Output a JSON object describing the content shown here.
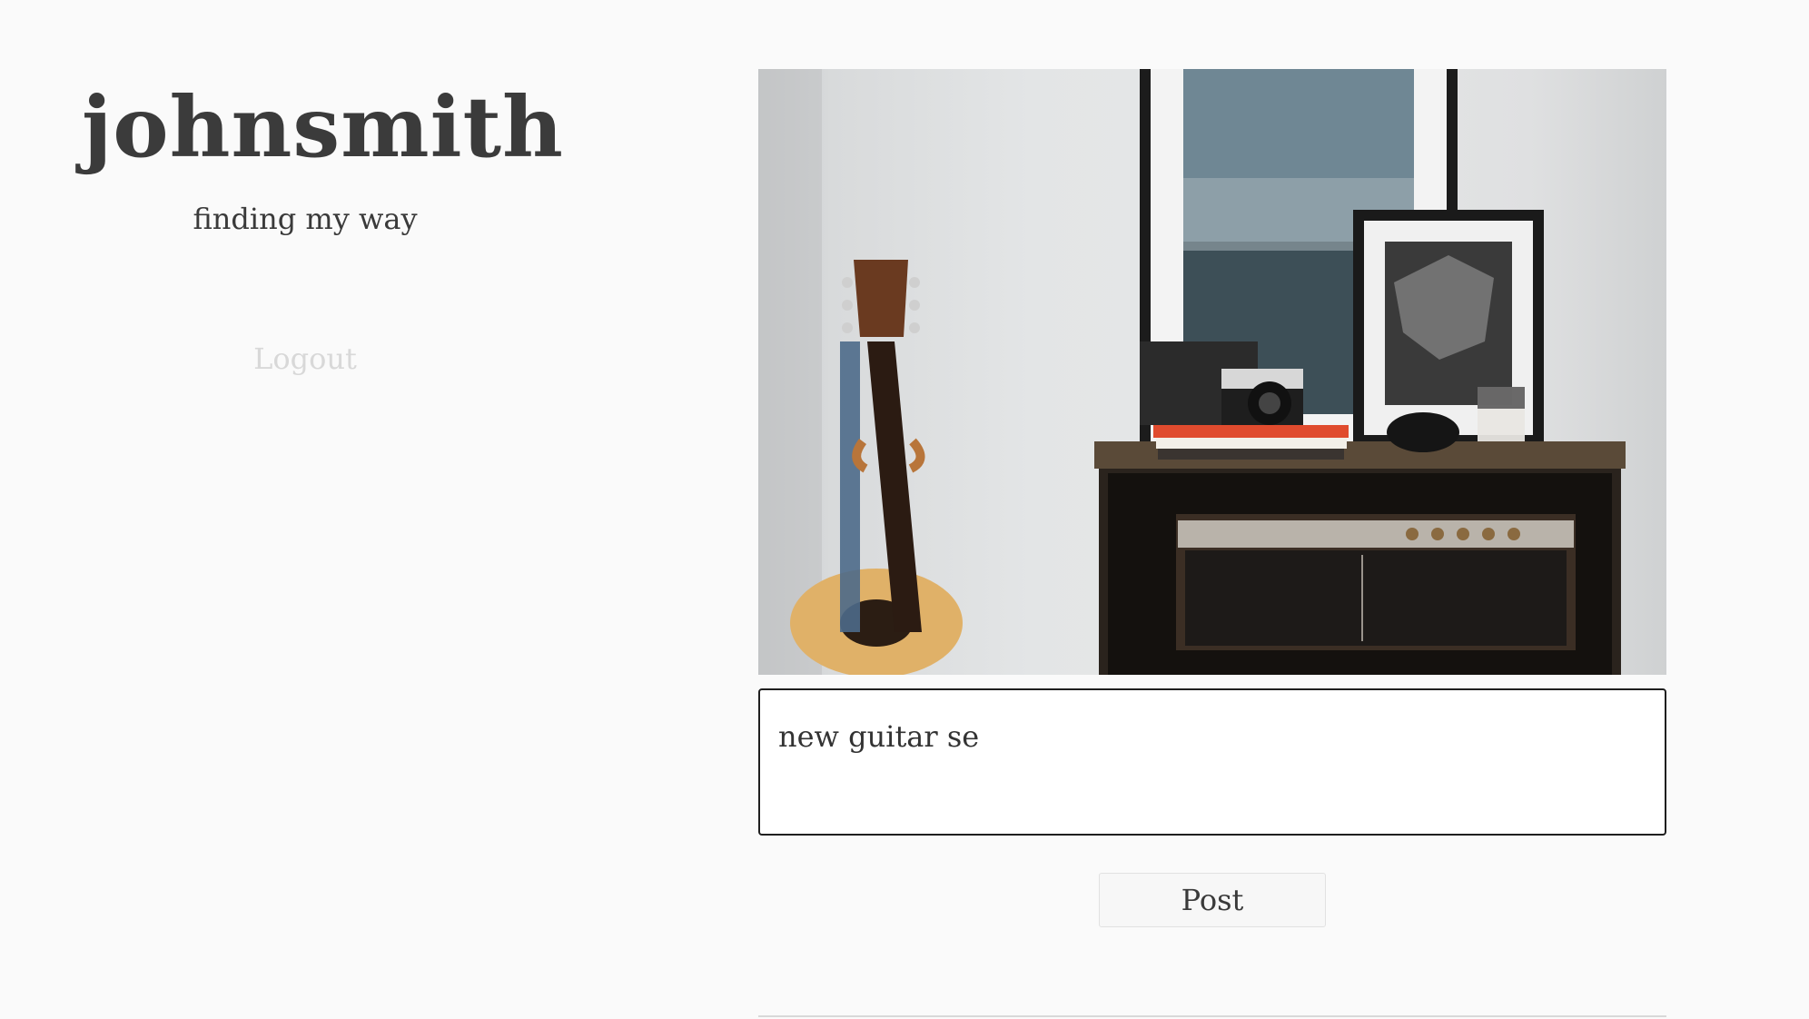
{
  "profile": {
    "username": "johnsmith",
    "tagline": "finding my way",
    "logout_label": "Logout"
  },
  "post": {
    "image_alt": "guitar, camera and radio on a wooden cabinet",
    "caption_value": "new guitar se",
    "post_label": "Post"
  },
  "colors": {
    "background": "#fafafa",
    "logout_text": "#d8d8d8",
    "input_border": "#1f1f1f"
  }
}
